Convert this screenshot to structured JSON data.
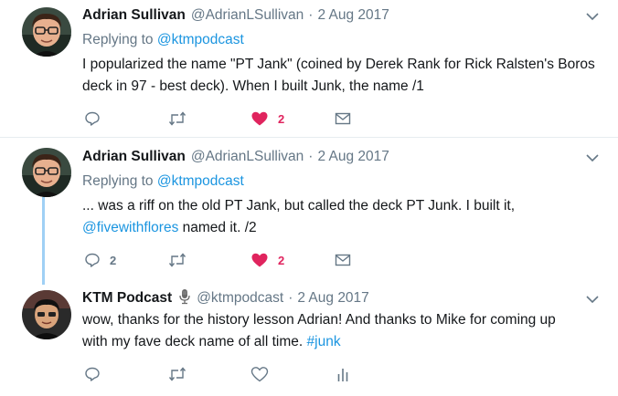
{
  "tweets": [
    {
      "author_name": "Adrian Sullivan",
      "author_handle": "@AdrianLSullivan",
      "separator": "·",
      "date": "2 Aug 2017",
      "replying_to_label": "Replying to",
      "replying_to_handle": "@ktmpodcast",
      "text_lines": [
        "I popularized the name \"PT Jank\" (coined by Derek Rank for Rick Ralsten's Boros",
        "deck in 97 - best deck). When I built Junk, the name /1"
      ],
      "reply_count": "",
      "retweet_count": "",
      "like_count": "2",
      "liked": true
    },
    {
      "author_name": "Adrian Sullivan",
      "author_handle": "@AdrianLSullivan",
      "separator": "·",
      "date": "2 Aug 2017",
      "replying_to_label": "Replying to",
      "replying_to_handle": "@ktmpodcast",
      "text_line1": "... was a riff on the old PT Jank, but called the deck PT Junk. I built it,",
      "mention": "@fivewithflores",
      "text_line2_rest": " named it. /2",
      "reply_count": "2",
      "retweet_count": "",
      "like_count": "2",
      "liked": true
    },
    {
      "author_name": "KTM Podcast",
      "author_badge_icon": "microphone-icon",
      "author_handle": "@ktmpodcast",
      "separator": "·",
      "date": "2 Aug 2017",
      "text_line1": "wow, thanks for the history lesson Adrian! And thanks to Mike for coming up",
      "text_line2": "with my fave deck name of all time. ",
      "hashtag": "#junk",
      "reply_count": "",
      "retweet_count": "",
      "like_count": "",
      "liked": false
    }
  ],
  "colors": {
    "link": "#1b95e0",
    "like_active": "#e0245e",
    "muted": "#657786",
    "thread_line": "#9fd0f5",
    "divider": "#e6ecf0"
  },
  "icons": [
    "reply-icon",
    "retweet-icon",
    "heart-icon",
    "mail-icon",
    "analytics-icon",
    "chevron-down-icon",
    "microphone-icon"
  ]
}
